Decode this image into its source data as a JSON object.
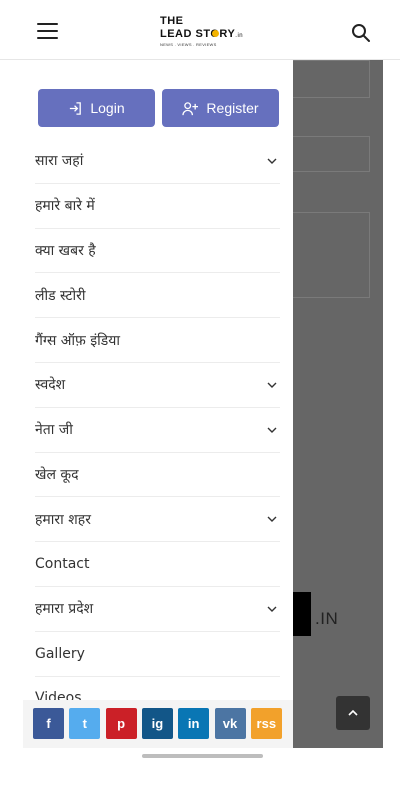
{
  "logo": {
    "line1": "THE",
    "line2": "LEAD STORY",
    "line2_suffix": ".in",
    "tagline": "NEWS . VIEWS . REVIEWS"
  },
  "header": {
    "menu_icon": "hamburger-icon",
    "search_icon": "search-icon"
  },
  "auth": {
    "login_label": "Login",
    "register_label": "Register",
    "login_icon": "sign-in-icon",
    "register_icon": "user-plus-icon",
    "button_color": "#6670be"
  },
  "menu": [
    {
      "label": "सारा जहां",
      "has_submenu": true
    },
    {
      "label": "हमारे बारे में",
      "has_submenu": false
    },
    {
      "label": "क्या खबर है",
      "has_submenu": false
    },
    {
      "label": "लीड स्टोरी",
      "has_submenu": false
    },
    {
      "label": "गैंग्स ऑफ़ इंडिया",
      "has_submenu": false
    },
    {
      "label": "स्वदेश",
      "has_submenu": true
    },
    {
      "label": "नेता जी",
      "has_submenu": true
    },
    {
      "label": "खेल कूद",
      "has_submenu": false
    },
    {
      "label": "हमारा शहर",
      "has_submenu": true
    },
    {
      "label": "Contact",
      "has_submenu": false
    },
    {
      "label": "हमारा प्रदेश",
      "has_submenu": true
    },
    {
      "label": "Gallery",
      "has_submenu": false
    },
    {
      "label": "Videos",
      "has_submenu": false
    }
  ],
  "background": {
    "brand_text": ".IN"
  },
  "social": [
    {
      "name": "facebook-icon",
      "glyph": "f",
      "color": "#3b5998"
    },
    {
      "name": "twitter-icon",
      "glyph": "t",
      "color": "#55acee"
    },
    {
      "name": "pinterest-icon",
      "glyph": "p",
      "color": "#cb2027"
    },
    {
      "name": "instagram-icon",
      "glyph": "ig",
      "color": "#125688"
    },
    {
      "name": "linkedin-icon",
      "glyph": "in",
      "color": "#0976b4"
    },
    {
      "name": "vk-icon",
      "glyph": "vk",
      "color": "#4c75a3"
    },
    {
      "name": "rss-icon",
      "glyph": "rss",
      "color": "#f2a12b"
    }
  ]
}
